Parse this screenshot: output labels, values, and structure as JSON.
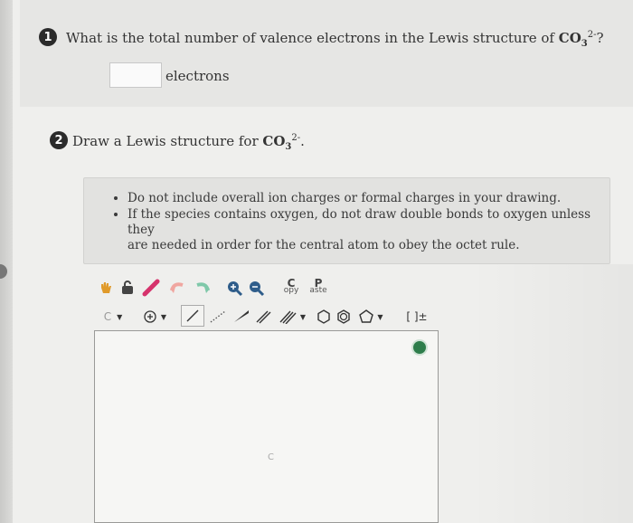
{
  "question1": {
    "number": "1",
    "text": "What is the total number of valence electrons in the Lewis structure of",
    "formula_main": "CO",
    "formula_sub": "3",
    "formula_sup": "2-",
    "suffix": "?",
    "answer_value": "",
    "unit": "electrons"
  },
  "question2": {
    "number": "2",
    "text": "Draw a Lewis structure for",
    "formula_main": "CO",
    "formula_sub": "3",
    "formula_sup": "2-",
    "suffix": ".",
    "notes": [
      "Do not include overall ion charges or formal charges in your drawing.",
      "If the species contains oxygen, do not draw double bonds to oxygen unless they",
      "are needed in order for the central atom to obey the octet rule."
    ]
  },
  "toolbar": {
    "copy_label_top": "C",
    "copy_label_bottom": "opy",
    "paste_label_top": "P",
    "paste_label_bottom": "aste",
    "element_label": "C",
    "bracket_label": "[ ]±"
  },
  "canvas": {
    "atom_label": "C"
  },
  "colors": {
    "badge": "#2b2b2b",
    "hand_tool": "#e09a2a",
    "eraser": "#d6336c",
    "help": "#2e7d4b"
  }
}
